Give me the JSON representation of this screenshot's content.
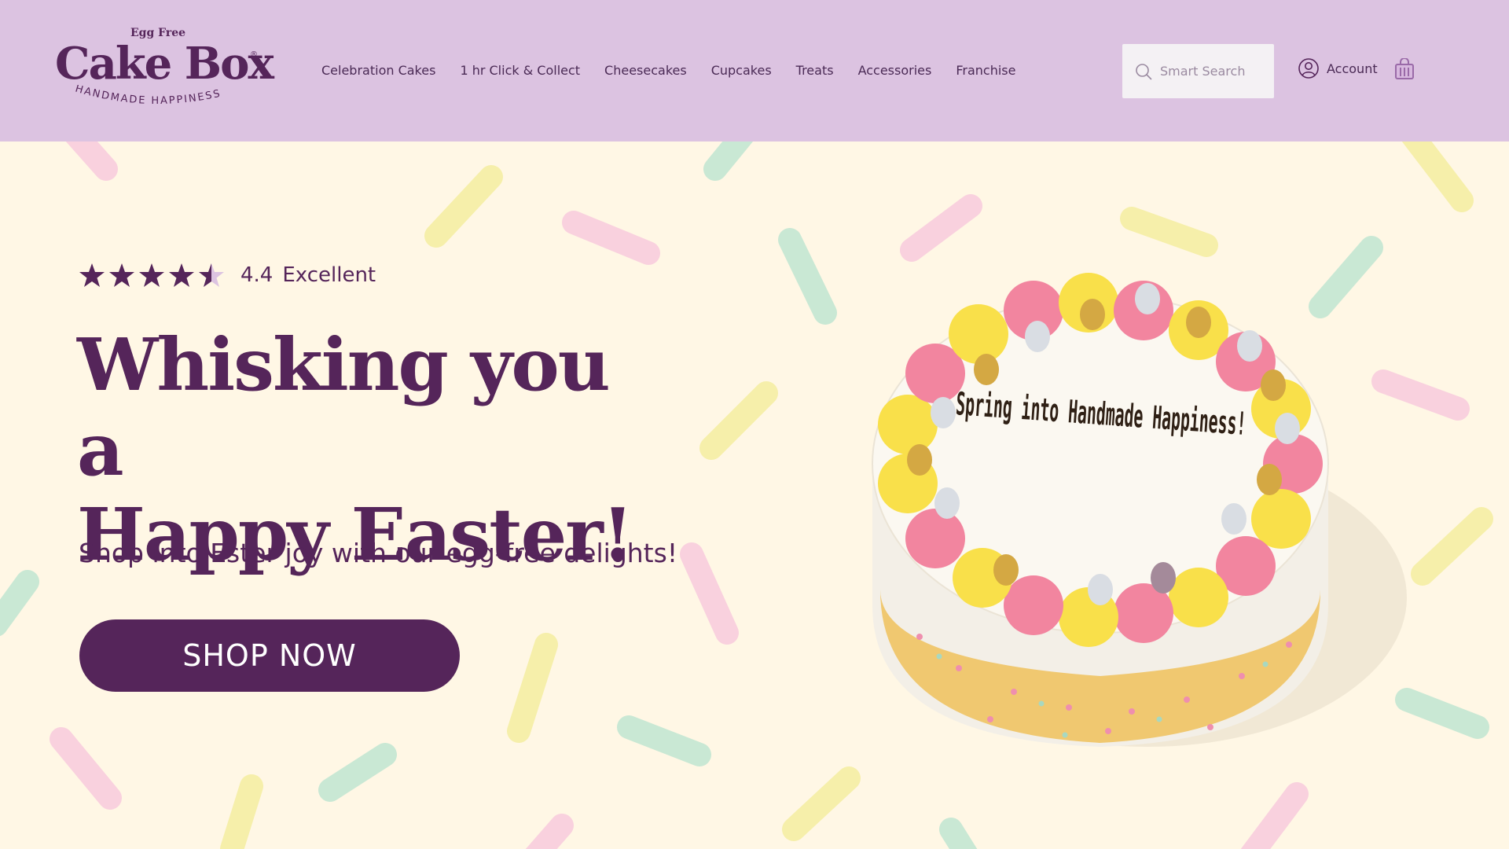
{
  "header": {
    "logo": {
      "tagline_top": "Egg Free",
      "brand": "Cake Box",
      "tagline_bottom": "HANDMADE HAPPINESS"
    },
    "nav": [
      "Celebration Cakes",
      "1 hr Click & Collect",
      "Cheesecakes",
      "Cupcakes",
      "Treats",
      "Accessories",
      "Franchise"
    ],
    "search": {
      "placeholder": "Smart Search",
      "icon": "search-icon"
    },
    "account_label": "Account",
    "basket_icon": "basket-icon"
  },
  "hero": {
    "rating": {
      "stars": 4.4,
      "score": "4.4",
      "word": "Excellent"
    },
    "headline_line1": "Whisking you a",
    "headline_line2": "Happy Easter!",
    "subline": "Shop into Ester joy with our egg-free delights!",
    "cta": "SHOP NOW",
    "cake_writing": "Spring into Handmade Happiness!"
  },
  "colors": {
    "header_bg": "#dcc3e1",
    "page_bg": "#fff7e5",
    "brand": "#55255a",
    "sprinkle_pink": "#f9d1de",
    "sprinkle_yellow": "#f6efaa",
    "sprinkle_mint": "#c9e8d4"
  }
}
